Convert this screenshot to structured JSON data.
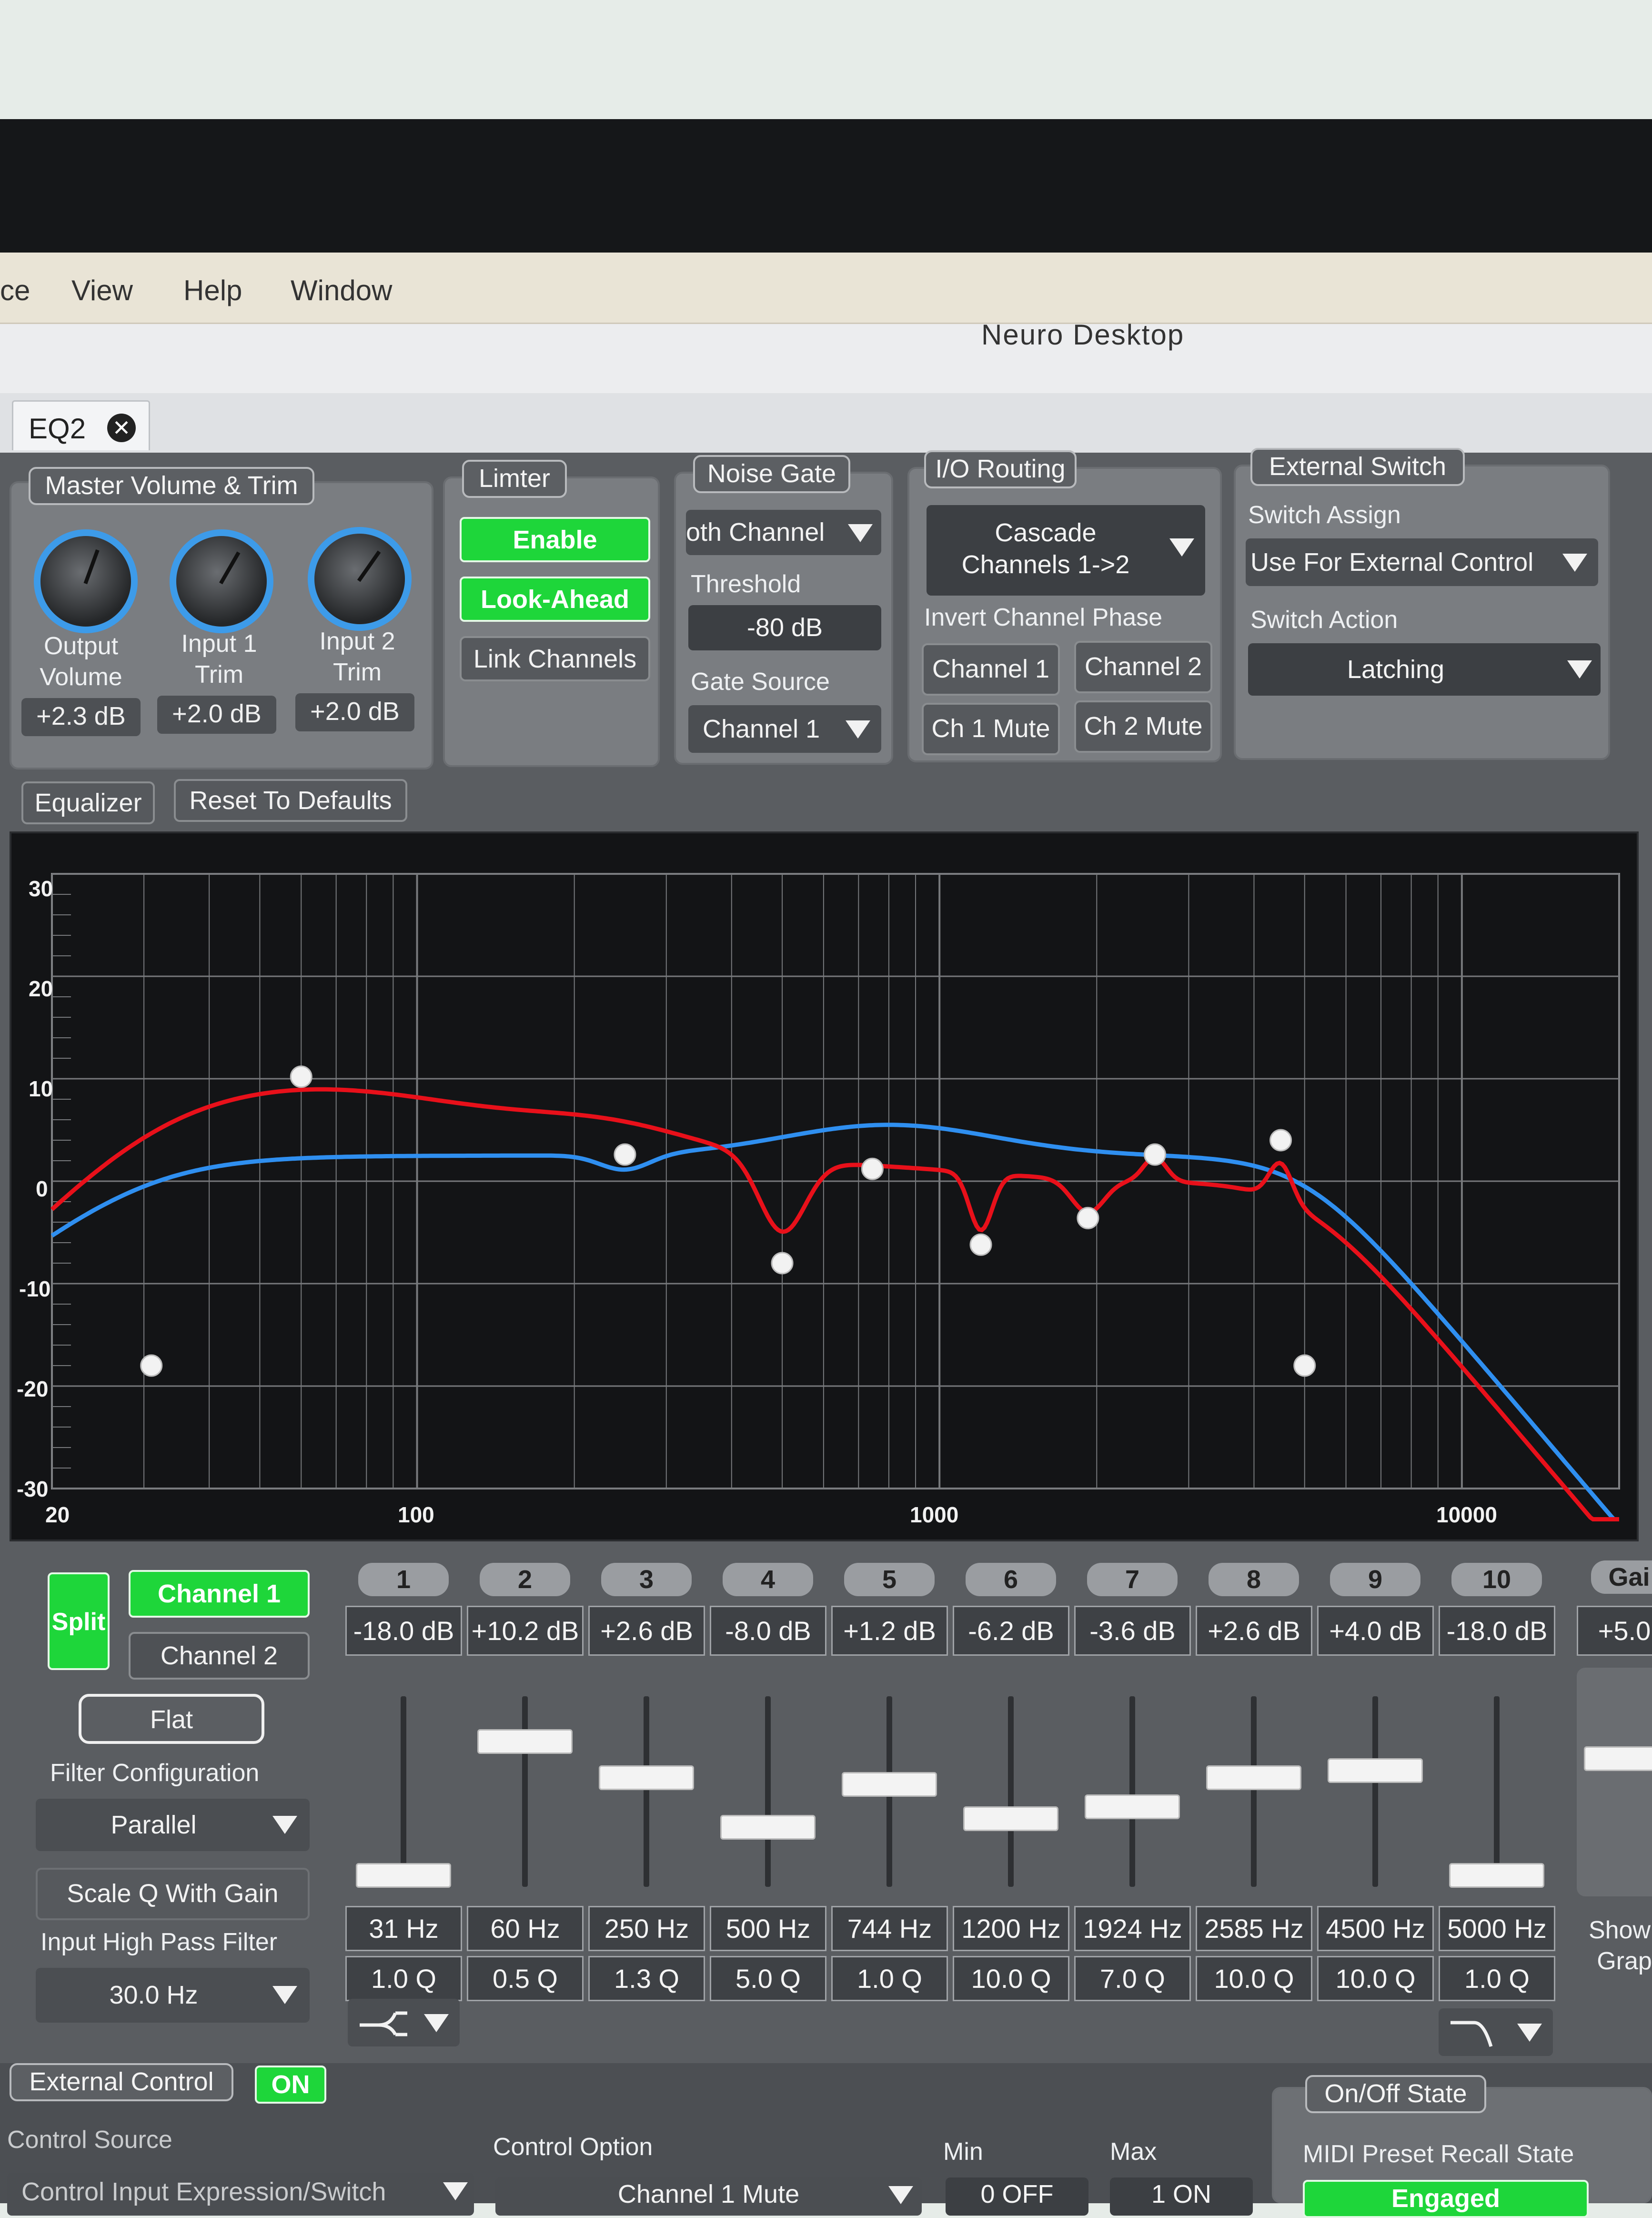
{
  "menu": {
    "items": [
      "ce",
      "View",
      "Help",
      "Window"
    ]
  },
  "window": {
    "title": "Neuro Desktop"
  },
  "tab": {
    "label": "EQ2"
  },
  "master": {
    "title": "Master Volume & Trim",
    "knobs": [
      {
        "label1": "Output",
        "label2": "Volume",
        "value": "+2.3 dB"
      },
      {
        "label1": "Input 1",
        "label2": "Trim",
        "value": "+2.0 dB"
      },
      {
        "label1": "Input 2",
        "label2": "Trim",
        "value": "+2.0 dB"
      }
    ]
  },
  "limiter": {
    "title": "Limter",
    "enable": "Enable",
    "lookahead": "Look-Ahead",
    "link": "Link Channels"
  },
  "gate": {
    "title": "Noise Gate",
    "channel": "oth Channel",
    "threshold_label": "Threshold",
    "threshold": "-80 dB",
    "source_label": "Gate Source",
    "source": "Channel 1"
  },
  "routing": {
    "title": "I/O Routing",
    "mode_line1": "Cascade",
    "mode_line2": "Channels 1->2",
    "invert_label": "Invert Channel Phase",
    "ch1": "Channel 1",
    "ch2": "Channel 2",
    "mute1": "Ch 1 Mute",
    "mute2": "Ch 2 Mute"
  },
  "ext_switch": {
    "title": "External Switch",
    "assign_label": "Switch Assign",
    "assign": "Use For External Control",
    "action_label": "Switch Action",
    "action": "Latching"
  },
  "eq_header": {
    "tab": "Equalizer",
    "reset": "Reset To Defaults"
  },
  "graph": {
    "y_ticks": [
      "30",
      "20",
      "10",
      "0",
      "-10",
      "-20",
      "-30"
    ],
    "x_ticks": [
      "20",
      "100",
      "1000",
      "10000"
    ],
    "colors": {
      "channel1": "#e8101a",
      "channel2": "#2f8ff0"
    }
  },
  "left_controls": {
    "split": "Split",
    "channel1": "Channel 1",
    "channel2": "Channel 2",
    "flat": "Flat",
    "filter_label": "Filter Configuration",
    "filter": "Parallel",
    "scale_q": "Scale Q With Gain",
    "hpf_label": "Input High Pass Filter",
    "hpf": "30.0 Hz"
  },
  "bands": [
    {
      "num": "1",
      "gain": "-18.0 dB",
      "freq": "31 Hz",
      "q": "1.0 Q",
      "level": 0.0
    },
    {
      "num": "2",
      "gain": "+10.2 dB",
      "freq": "60 Hz",
      "q": "0.5 Q",
      "level": 0.78
    },
    {
      "num": "3",
      "gain": "+2.6 dB",
      "freq": "250 Hz",
      "q": "1.3 Q",
      "level": 0.57
    },
    {
      "num": "4",
      "gain": "-8.0 dB",
      "freq": "500 Hz",
      "q": "5.0 Q",
      "level": 0.28
    },
    {
      "num": "5",
      "gain": "+1.2 dB",
      "freq": "744 Hz",
      "q": "1.0 Q",
      "level": 0.53
    },
    {
      "num": "6",
      "gain": "-6.2 dB",
      "freq": "1200 Hz",
      "q": "10.0 Q",
      "level": 0.33
    },
    {
      "num": "7",
      "gain": "-3.6 dB",
      "freq": "1924 Hz",
      "q": "7.0 Q",
      "level": 0.4
    },
    {
      "num": "8",
      "gain": "+2.6 dB",
      "freq": "2585 Hz",
      "q": "10.0 Q",
      "level": 0.57
    },
    {
      "num": "9",
      "gain": "+4.0 dB",
      "freq": "4500 Hz",
      "q": "10.0 Q",
      "level": 0.61
    },
    {
      "num": "10",
      "gain": "-18.0 dB",
      "freq": "5000 Hz",
      "q": "1.0 Q",
      "level": 0.0
    }
  ],
  "right_edge": {
    "gain_label": "Gai",
    "gain_value": "+5.0",
    "show_label1": "Show",
    "show_label2": "Grap"
  },
  "footer": {
    "ext_control": "External Control",
    "on": "ON",
    "control_source": "Control Source",
    "control_input": "Control Input Expression/Switch",
    "control_option": "Control Option",
    "option_value": "Channel 1 Mute",
    "min_label": "Min",
    "min_value": "0 OFF",
    "max_label": "Max",
    "max_value": "1 ON",
    "onoff_title": "On/Off State",
    "midi_label": "MIDI Preset Recall State",
    "midi_value": "Engaged"
  }
}
